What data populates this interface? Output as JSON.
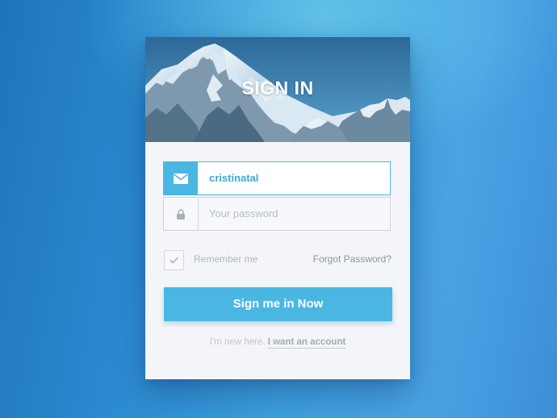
{
  "header": {
    "title": "SIGN IN"
  },
  "form": {
    "username": {
      "value": "cristinatal",
      "icon": "envelope-icon"
    },
    "password": {
      "value": "",
      "placeholder": "Your password",
      "icon": "lock-icon"
    },
    "remember": {
      "label": "Remember me",
      "checked": false
    },
    "forgot_label": "Forgot Password?",
    "submit_label": "Sign me in Now"
  },
  "footer": {
    "prefix": "I'm new here.",
    "link_label": "I want an account"
  },
  "colors": {
    "accent": "#4ab7e3",
    "card_background": "#f4f5f9",
    "page_background": "#3c97d9"
  }
}
